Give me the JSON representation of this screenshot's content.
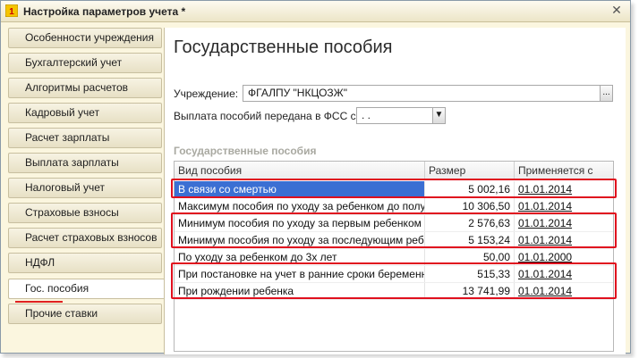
{
  "window": {
    "title": "Настройка параметров учета *",
    "close_symbol": "✕"
  },
  "sidebar": {
    "items": [
      {
        "label": "Особенности учреждения"
      },
      {
        "label": "Бухгалтерский учет"
      },
      {
        "label": "Алгоритмы расчетов"
      },
      {
        "label": "Кадровый учет"
      },
      {
        "label": "Расчет зарплаты"
      },
      {
        "label": "Выплата зарплаты"
      },
      {
        "label": "Налоговый учет"
      },
      {
        "label": "Страховые взносы"
      },
      {
        "label": "Расчет страховых взносов"
      },
      {
        "label": "НДФЛ"
      },
      {
        "label": "Гос. пособия",
        "active": true
      },
      {
        "label": "Прочие ставки"
      }
    ]
  },
  "main": {
    "title": "Государственные пособия",
    "institution": {
      "label": "Учреждение:",
      "value": "ФГАЛПУ \"НКЦОЗЖ\"",
      "button": "..."
    },
    "fss": {
      "label": "Выплата пособий передана в ФСС с:",
      "value": " .  .",
      "dropdown_symbol": "▼"
    },
    "section_title": "Государственные пособия",
    "table": {
      "columns": [
        "Вид пособия",
        "Размер",
        "Применяется с"
      ],
      "rows": [
        {
          "kind": "В связи со смертью",
          "amount": "5 002,16",
          "date": "01.01.2014",
          "selected": true
        },
        {
          "kind": "Максимум пособия по уходу за ребенком до полут...",
          "amount": "10 306,50",
          "date": "01.01.2014"
        },
        {
          "kind": "Минимум пособия по уходу за первым ребенком д...",
          "amount": "2 576,63",
          "date": "01.01.2014"
        },
        {
          "kind": "Минимум пособия по уходу за последующим ребен...",
          "amount": "5 153,24",
          "date": "01.01.2014"
        },
        {
          "kind": "По уходу за ребенком до 3х лет",
          "amount": "50,00",
          "date": "01.01.2000"
        },
        {
          "kind": "При постановке на учет в ранние сроки беременно...",
          "amount": "515,33",
          "date": "01.01.2014"
        },
        {
          "kind": "При рождении ребенка",
          "amount": "13 741,99",
          "date": "01.01.2014"
        }
      ]
    }
  },
  "colors": {
    "highlight_red": "#e0101e",
    "selection_blue": "#3b6fd3",
    "window_bg": "#fbf6df"
  },
  "icons": {
    "app": "app-logo-icon",
    "close": "close-icon",
    "dropdown": "chevron-down-icon",
    "select": "ellipsis-icon"
  }
}
